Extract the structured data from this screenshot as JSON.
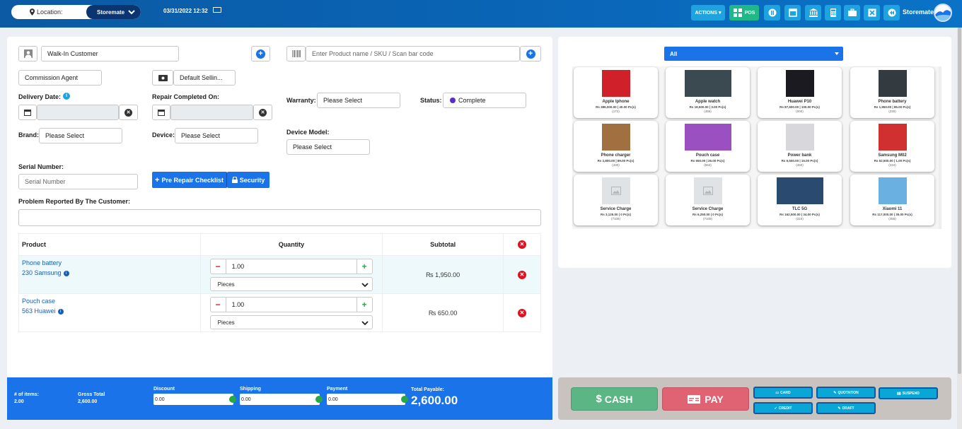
{
  "topbar": {
    "location_label": "Location:",
    "location_value": "Storemate",
    "datetime": "03/31/2022 12:32",
    "actions_label": "ACTIONS",
    "pos_label": "POS",
    "store_name": "Storemate"
  },
  "form": {
    "customer": "Walk-In Customer",
    "product_search_placeholder": "Enter Product name / SKU / Scan bar code",
    "commission_agent": "Commission Agent",
    "selling_price": "Default Sellin...",
    "delivery_date_label": "Delivery Date:",
    "repair_completed_label": "Repair Completed On:",
    "warranty_label": "Warranty:",
    "warranty_value": "Please Select",
    "status_label": "Status:",
    "status_value": "Complete",
    "brand_label": "Brand:",
    "brand_value": "Please Select",
    "device_label": "Device:",
    "device_value": "Please Select",
    "device_model_label": "Device Model:",
    "device_model_value": "Please Select",
    "serial_label": "Serial Number:",
    "serial_placeholder": "Serial Number",
    "checklist_btn": "Pre Repair Checklist",
    "security_btn": "Security",
    "problem_label": "Problem Reported By The Customer:"
  },
  "table": {
    "headers": [
      "Product",
      "Quantity",
      "Subtotal"
    ],
    "rows": [
      {
        "name": "Phone battery",
        "sku": "230 Samsung",
        "qty": "1.00",
        "unit": "Pieces",
        "subtotal": "₨ 1,950.00"
      },
      {
        "name": "Pouch case",
        "sku": "563 Huawei",
        "qty": "1.00",
        "unit": "Pieces",
        "subtotal": "₨ 650.00"
      }
    ]
  },
  "totals": {
    "items_label": "# of items:",
    "items_value": "2.00",
    "gross_label": "Gross Total",
    "gross_value": "2,600.00",
    "discount_label": "Discount",
    "discount_value": "0.00",
    "shipping_label": "Shipping",
    "shipping_value": "0.00",
    "payment_label": "Payment",
    "payment_value": "0.00",
    "payable_label": "Total Payable:",
    "payable_value": "2,600.00"
  },
  "catalog": {
    "filter": "All",
    "products": [
      {
        "name": "Apple Iphone",
        "price": "Rs 386,000.00 | 40.00 Pc(s)",
        "stock": "(172)",
        "color": "#d0202a"
      },
      {
        "name": "Apple watch",
        "price": "Rs 18,500.00 | 3.00 Pc(s)",
        "stock": "(456)",
        "color": "#3a4a50"
      },
      {
        "name": "Huawei P10",
        "price": "Rs 87,600.00 | 100.00 Pc(s)",
        "stock": "(000)",
        "color": "#1a1a20"
      },
      {
        "name": "Phone battery",
        "price": "Rs 1,950.00 | 85.00 Pc(s)",
        "stock": "(230)",
        "color": "#333a40"
      },
      {
        "name": "Phone charger",
        "price": "Rs 2,800.00 | 89.00 Pc(s)",
        "stock": "(430)",
        "color": "#a07040"
      },
      {
        "name": "Pouch case",
        "price": "Rs 650.00 | 26.00 Pc(s)",
        "stock": "(563)",
        "color": "#9a50c0"
      },
      {
        "name": "Power bank",
        "price": "Rs 6,500.00 | 15.00 Pc(s)",
        "stock": "(450)",
        "color": "#d8d8dc"
      },
      {
        "name": "Samsung M02",
        "price": "Rs 62,500.00 | 1.00 Pc(s)",
        "stock": "(234)",
        "color": "#d03030"
      },
      {
        "name": "Service Charge",
        "price": "Rs 3,125.00 | 0 Pc(s)",
        "stock": "(7108)",
        "color": "#dfe3e6"
      },
      {
        "name": "Service Charge",
        "price": "Rs 6,250.00 | 0 Pc(s)",
        "stock": "(7109)",
        "color": "#dfe3e6"
      },
      {
        "name": "TLC 5G",
        "price": "Rs 162,500.00 | 34.00 Pc(s)",
        "stock": "(310)",
        "color": "#2a4a70"
      },
      {
        "name": "Xiaomi 11",
        "price": "Rs 117,000.00 | 35.00 Pc(s)",
        "stock": "(455)",
        "color": "#6ab0e0"
      }
    ]
  },
  "payment": {
    "cash": "CASH",
    "pay": "PAY",
    "card": "CARD",
    "quotation": "QUOTATION",
    "suspend": "SUSPEND",
    "credit": "CREDIT",
    "draft": "DRAFT"
  }
}
